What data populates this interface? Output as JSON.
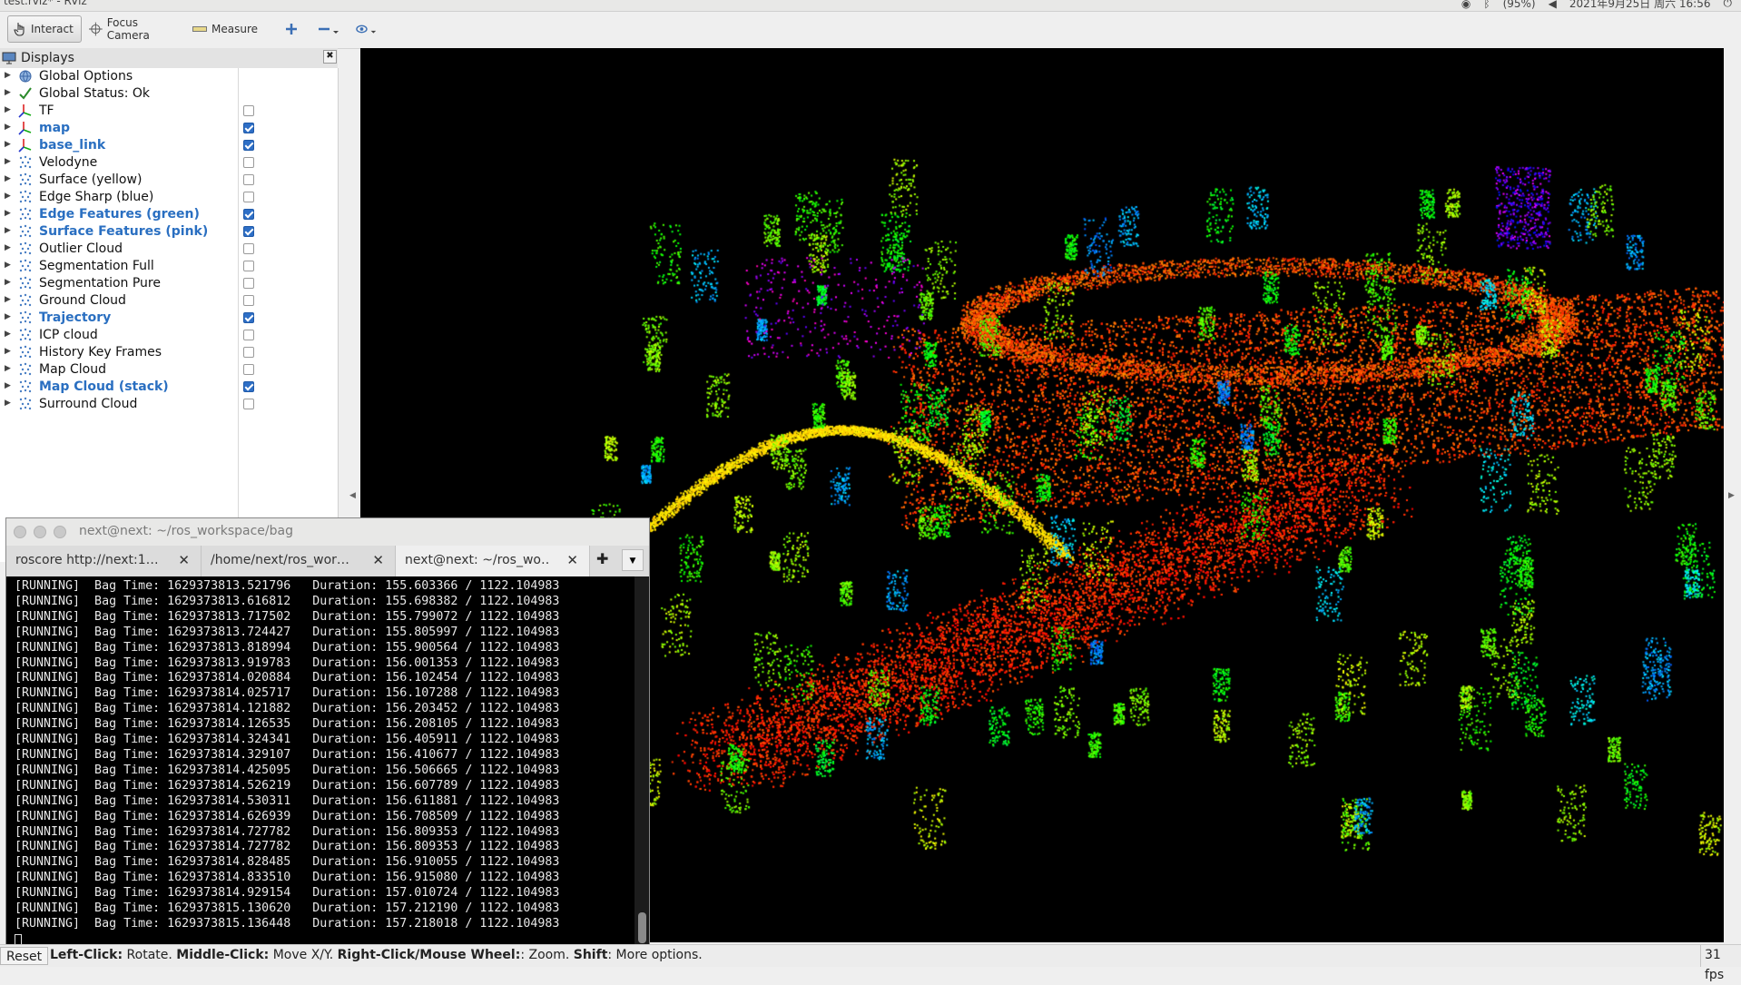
{
  "window": {
    "title": "test.rviz* - RViz",
    "clock": "2021年9月25日 周六 16:56",
    "battery": "(95%)"
  },
  "toolbar": {
    "interact": "Interact",
    "focus_camera": "Focus Camera",
    "measure": "Measure"
  },
  "displays_panel": {
    "title": "Displays",
    "items": [
      {
        "label": "Global Options",
        "icon": "globe-icon",
        "checkbox": null,
        "checked": false
      },
      {
        "label": "Global Status: Ok",
        "icon": "check-icon",
        "checkbox": null,
        "checked": false
      },
      {
        "label": "TF",
        "icon": "axes-icon",
        "checkbox": true,
        "checked": false
      },
      {
        "label": "map",
        "icon": "axes-icon",
        "checkbox": true,
        "checked": true
      },
      {
        "label": "base_link",
        "icon": "axes-icon",
        "checkbox": true,
        "checked": true
      },
      {
        "label": "Velodyne",
        "icon": "pointcloud-icon",
        "checkbox": true,
        "checked": false
      },
      {
        "label": "Surface (yellow)",
        "icon": "pointcloud-icon",
        "checkbox": true,
        "checked": false
      },
      {
        "label": "Edge Sharp (blue)",
        "icon": "pointcloud-icon",
        "checkbox": true,
        "checked": false
      },
      {
        "label": "Edge Features (green)",
        "icon": "pointcloud-icon",
        "checkbox": true,
        "checked": true
      },
      {
        "label": "Surface Features (pink)",
        "icon": "pointcloud-icon",
        "checkbox": true,
        "checked": true
      },
      {
        "label": "Outlier Cloud",
        "icon": "pointcloud-icon",
        "checkbox": true,
        "checked": false
      },
      {
        "label": "Segmentation Full",
        "icon": "pointcloud-icon",
        "checkbox": true,
        "checked": false
      },
      {
        "label": "Segmentation Pure",
        "icon": "pointcloud-icon",
        "checkbox": true,
        "checked": false
      },
      {
        "label": "Ground Cloud",
        "icon": "pointcloud-icon",
        "checkbox": true,
        "checked": false
      },
      {
        "label": "Trajectory",
        "icon": "pointcloud-icon",
        "checkbox": true,
        "checked": true
      },
      {
        "label": "ICP cloud",
        "icon": "pointcloud-icon",
        "checkbox": true,
        "checked": false
      },
      {
        "label": "History Key Frames",
        "icon": "pointcloud-icon",
        "checkbox": true,
        "checked": false
      },
      {
        "label": "Map Cloud",
        "icon": "pointcloud-icon",
        "checkbox": true,
        "checked": false
      },
      {
        "label": "Map Cloud (stack)",
        "icon": "pointcloud-icon",
        "checkbox": true,
        "checked": true
      },
      {
        "label": "Surround Cloud",
        "icon": "pointcloud-icon",
        "checkbox": true,
        "checked": false
      }
    ]
  },
  "terminal": {
    "title": "next@next: ~/ros_workspace/bag",
    "tabs": [
      "roscore http://next:1…",
      "/home/next/ros_wor…",
      "next@next: ~/ros_wo…"
    ],
    "lines": [
      "[RUNNING]  Bag Time: 1629373813.521796   Duration: 155.603366 / 1122.104983",
      "[RUNNING]  Bag Time: 1629373813.616812   Duration: 155.698382 / 1122.104983",
      "[RUNNING]  Bag Time: 1629373813.717502   Duration: 155.799072 / 1122.104983",
      "[RUNNING]  Bag Time: 1629373813.724427   Duration: 155.805997 / 1122.104983",
      "[RUNNING]  Bag Time: 1629373813.818994   Duration: 155.900564 / 1122.104983",
      "[RUNNING]  Bag Time: 1629373813.919783   Duration: 156.001353 / 1122.104983",
      "[RUNNING]  Bag Time: 1629373814.020884   Duration: 156.102454 / 1122.104983",
      "[RUNNING]  Bag Time: 1629373814.025717   Duration: 156.107288 / 1122.104983",
      "[RUNNING]  Bag Time: 1629373814.121882   Duration: 156.203452 / 1122.104983",
      "[RUNNING]  Bag Time: 1629373814.126535   Duration: 156.208105 / 1122.104983",
      "[RUNNING]  Bag Time: 1629373814.324341   Duration: 156.405911 / 1122.104983",
      "[RUNNING]  Bag Time: 1629373814.329107   Duration: 156.410677 / 1122.104983",
      "[RUNNING]  Bag Time: 1629373814.425095   Duration: 156.506665 / 1122.104983",
      "[RUNNING]  Bag Time: 1629373814.526219   Duration: 156.607789 / 1122.104983",
      "[RUNNING]  Bag Time: 1629373814.530311   Duration: 156.611881 / 1122.104983",
      "[RUNNING]  Bag Time: 1629373814.626939   Duration: 156.708509 / 1122.104983",
      "[RUNNING]  Bag Time: 1629373814.727782   Duration: 156.809353 / 1122.104983",
      "[RUNNING]  Bag Time: 1629373814.727782   Duration: 156.809353 / 1122.104983",
      "[RUNNING]  Bag Time: 1629373814.828485   Duration: 156.910055 / 1122.104983",
      "[RUNNING]  Bag Time: 1629373814.833510   Duration: 156.915080 / 1122.104983",
      "[RUNNING]  Bag Time: 1629373814.929154   Duration: 157.010724 / 1122.104983",
      "[RUNNING]  Bag Time: 1629373815.130620   Duration: 157.212190 / 1122.104983",
      "[RUNNING]  Bag Time: 1629373815.136448   Duration: 157.218018 / 1122.104983"
    ]
  },
  "statusbar": {
    "reset": "Reset",
    "hint_b1": "Left-Click:",
    "hint_t1": " Rotate. ",
    "hint_b2": "Middle-Click:",
    "hint_t2": " Move X/Y. ",
    "hint_b3": "Right-Click/Mouse Wheel:",
    "hint_t3": ": Zoom. ",
    "hint_b4": "Shift",
    "hint_t4": ": More options.",
    "fps": "31 fps"
  }
}
